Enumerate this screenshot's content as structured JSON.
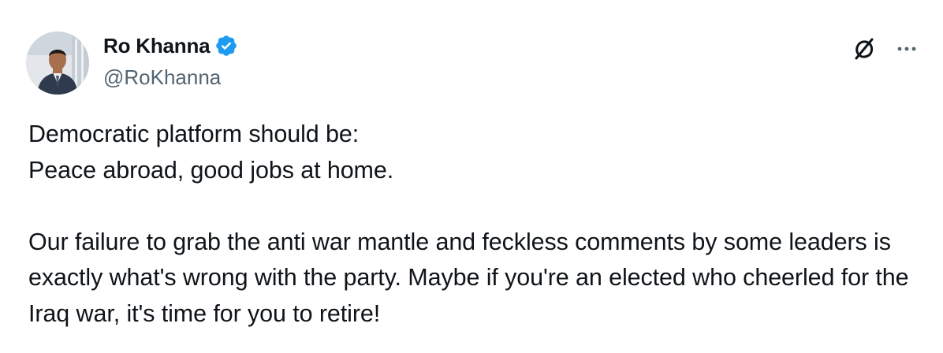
{
  "author": {
    "display_name": "Ro Khanna",
    "handle": "@RoKhanna",
    "verified": true
  },
  "icons": {
    "verified": "verified-badge-icon",
    "grok": "grok-icon",
    "more": "more-options-icon",
    "accent_color": "#1d9bf0"
  },
  "tweet": {
    "lines_paragraph_1": [
      "Democratic platform should be:",
      "Peace abroad, good jobs at home."
    ],
    "paragraph_2": "Our failure to grab the anti war mantle and feckless comments by some leaders is exactly what's wrong with the party. Maybe if you're an elected who cheerled for the Iraq war, it's time for you to retire!"
  }
}
